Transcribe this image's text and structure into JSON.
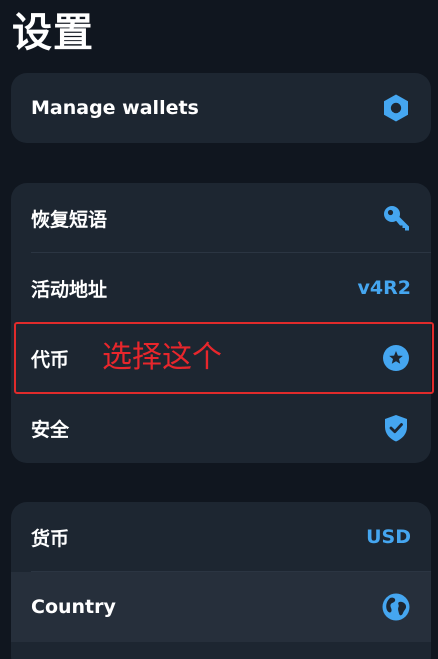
{
  "page": {
    "title": "设置"
  },
  "wallet_card": {
    "items": [
      {
        "label": "Manage wallets",
        "icon": "hexagon-settings-icon"
      }
    ]
  },
  "main_card": {
    "items": [
      {
        "label": "恢复短语",
        "icon": "key-icon"
      },
      {
        "label": "活动地址",
        "value": "v4R2"
      },
      {
        "label": "代币",
        "icon": "star-badge-icon"
      },
      {
        "label": "安全",
        "icon": "shield-check-icon"
      }
    ]
  },
  "locale_card": {
    "items": [
      {
        "label": "货币",
        "value": "USD"
      },
      {
        "label": "Country",
        "icon": "globe-icon"
      }
    ]
  },
  "annotation": {
    "text": "选择这个"
  },
  "colors": {
    "background": "#10161f",
    "card": "#1d2631",
    "accent": "#45a6f0",
    "annotation": "#e02b2b"
  }
}
